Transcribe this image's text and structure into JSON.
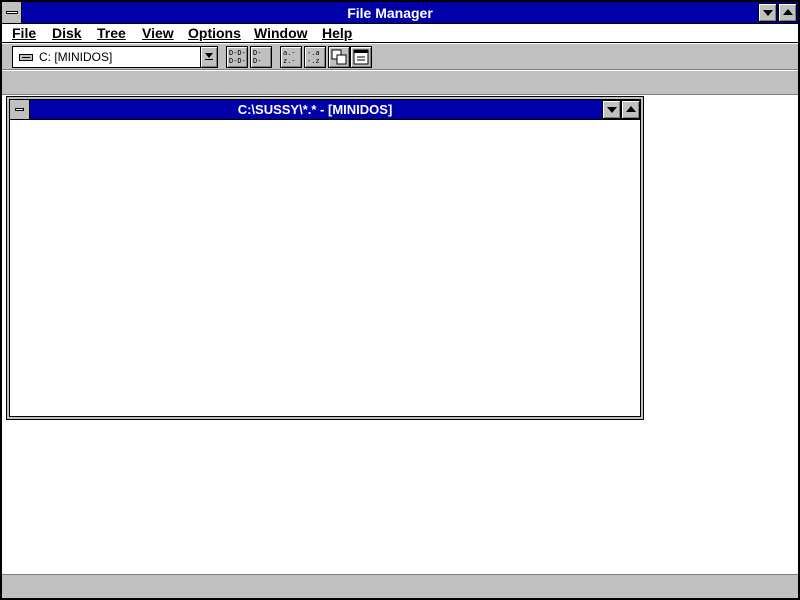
{
  "window": {
    "title": "File Manager"
  },
  "menu": {
    "items": [
      "File",
      "Disk",
      "Tree",
      "View",
      "Options",
      "Window",
      "Help"
    ]
  },
  "toolbar": {
    "drive_selected": "C: [MINIDOS]",
    "buttons": [
      {
        "icon": "tree-and-directory-icon",
        "glyph": "D-D-\nD-D-"
      },
      {
        "icon": "directory-only-icon",
        "glyph": "D-\nD-"
      },
      {
        "icon": "sort-by-name-icon",
        "glyph": "a.-\nz.-"
      },
      {
        "icon": "sort-by-type-icon",
        "glyph": "-.a\n-.z"
      },
      {
        "icon": "new-window-icon",
        "glyph": ""
      },
      {
        "icon": "file-details-icon",
        "glyph": ""
      }
    ]
  },
  "child_window": {
    "title": "C:\\SUSSY\\*.* - [MINIDOS]"
  },
  "colors": {
    "title_active": "#0000a8",
    "chrome": "#c0c0c0",
    "background": "#ffffff"
  }
}
